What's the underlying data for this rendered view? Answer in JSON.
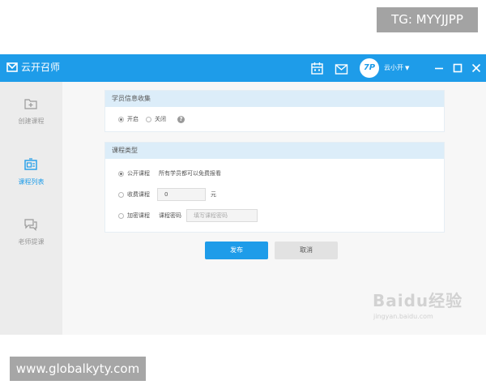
{
  "watermarks": {
    "top": "TG: MYYJJPP",
    "bottom": "www.globalkyty.com"
  },
  "app": {
    "name": "云开召师",
    "username": "云小开",
    "avatar_text": "7P"
  },
  "titlebar_icons": [
    "calendar-icon",
    "mail-icon",
    "minimize-icon",
    "maximize-icon",
    "close-icon"
  ],
  "sidebar": {
    "items": [
      {
        "label": "创建课程",
        "icon": "create-course-icon",
        "active": false
      },
      {
        "label": "课程列表",
        "icon": "course-list-icon",
        "active": true
      },
      {
        "label": "老师提课",
        "icon": "chat-icon",
        "active": false
      }
    ]
  },
  "student_info": {
    "title": "学员信息收集",
    "options": [
      {
        "label": "开启",
        "checked": true
      },
      {
        "label": "关闭",
        "checked": false
      }
    ]
  },
  "course_type": {
    "title": "课程类型",
    "public": {
      "label": "公开课程",
      "note": "所有学员都可以免费报看",
      "checked": true
    },
    "paid": {
      "label": "收费课程",
      "value": "0",
      "unit": "元",
      "checked": false
    },
    "encrypted": {
      "label": "加密课程",
      "password_label": "课程密码",
      "placeholder": "填写课程密码",
      "checked": false
    }
  },
  "buttons": {
    "publish": "发布",
    "cancel": "取消"
  },
  "watermark_logo": {
    "text": "Baidu经验",
    "sub": "jingyan.baidu.com"
  },
  "colors": {
    "primary": "#1e9ce9",
    "header_bg": "#dcedf9",
    "sidebar_bg": "#ececec"
  }
}
